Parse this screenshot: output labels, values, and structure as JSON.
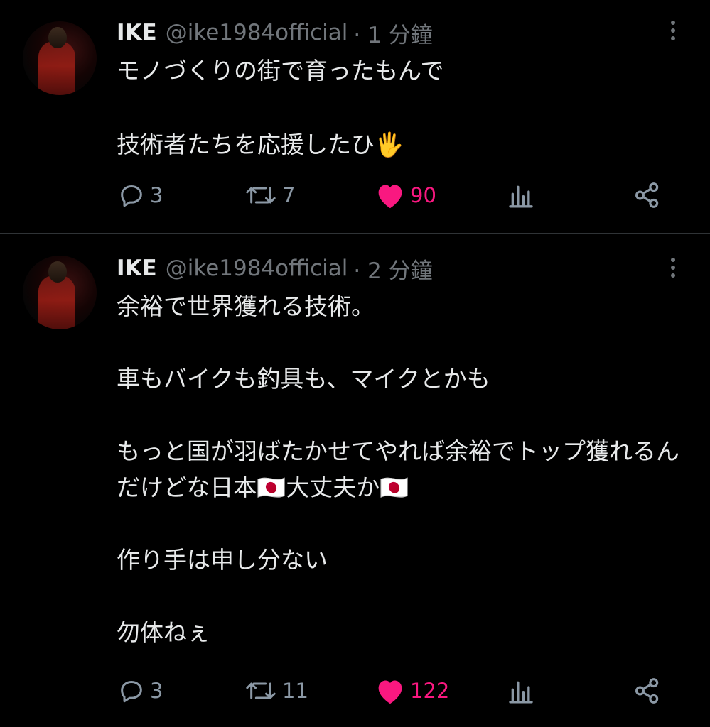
{
  "tweets": [
    {
      "name": "IKE",
      "handle": "@ike1984official",
      "time": "· 1 分鐘",
      "text": "モノづくりの街で育ったもんで\n\n技術者たちを応援したひ🖐",
      "replies": "3",
      "retweets": "7",
      "likes": "90"
    },
    {
      "name": "IKE",
      "handle": "@ike1984official",
      "time": "· 2 分鐘",
      "text": "余裕で世界獲れる技術。\n\n車もバイクも釣具も、マイクとかも\n\nもっと国が羽ばたかせてやれば余裕でトップ獲れるんだけどな日本🇯🇵大丈夫か🇯🇵\n\n作り手は申し分ない\n\n勿体ねぇ",
      "replies": "3",
      "retweets": "11",
      "likes": "122"
    }
  ],
  "colors": {
    "background": "#000000",
    "text": "#e7e9ea",
    "secondary": "#71767b",
    "like": "#f91880",
    "divider": "#2f3336"
  },
  "icons": [
    "reply-icon",
    "retweet-icon",
    "heart-icon",
    "analytics-icon",
    "share-icon",
    "more-icon"
  ]
}
